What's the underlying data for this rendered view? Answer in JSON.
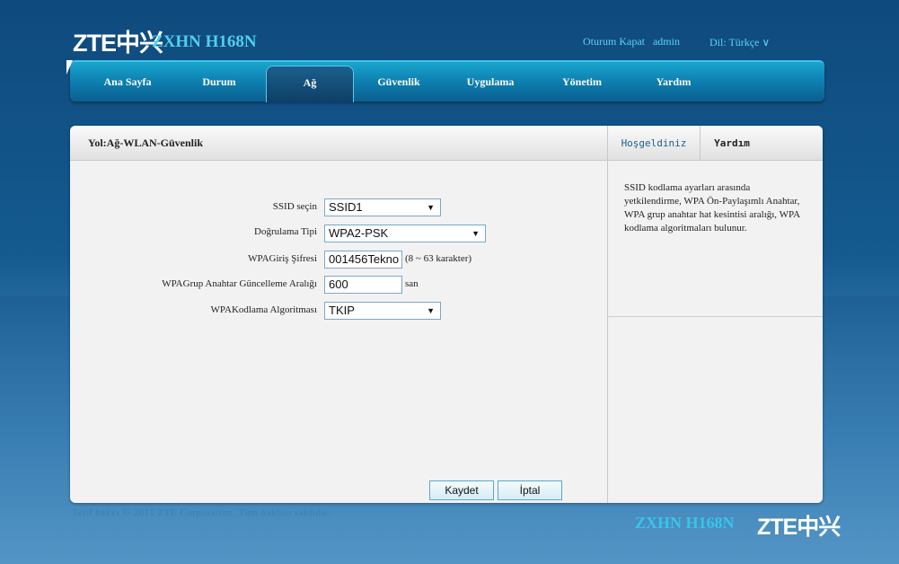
{
  "brand": {
    "logo": "ZTE中兴",
    "model": "ZXHN H168N"
  },
  "header": {
    "logout": "Oturum Kapat",
    "user": "admin",
    "language": "Dil: Türkçe ∨"
  },
  "nav": {
    "items": [
      {
        "label": "Ana Sayfa"
      },
      {
        "label": "Durum"
      },
      {
        "label": "Ağ"
      },
      {
        "label": "Güvenlik"
      },
      {
        "label": "Uygulama"
      },
      {
        "label": "Yönetim"
      },
      {
        "label": "Yardım"
      }
    ],
    "active": "Ağ"
  },
  "breadcrumb": "Yol:Ağ-WLAN-Güvenlik",
  "form": {
    "ssid": {
      "label": "SSID seçin",
      "value": "SSID1"
    },
    "auth_type": {
      "label": "Doğrulama Tipi",
      "value": "WPA2-PSK"
    },
    "password": {
      "label": "WPAGiriş Şifresi",
      "value": "001456Tekno",
      "hint": "(8 ~ 63 karakter)"
    },
    "group_key_interval": {
      "label": "WPAGrup Anahtar Güncelleme Aralığı",
      "value": "600",
      "unit": "san"
    },
    "encryption": {
      "label": "WPAKodlama Algoritması",
      "value": "TKIP"
    }
  },
  "buttons": {
    "save": "Kaydet",
    "cancel": "İptal"
  },
  "side": {
    "tab_welcome": "Hoşgeldiniz",
    "tab_help": "Yardım",
    "help_text": "SSID kodlama ayarları arasında yetkilendirme, WPA Ön-Paylaşımlı Anahtar, WPA grup anahtar hat kesintisi aralığı, WPA kodlama algoritmaları bulunur."
  },
  "footer": {
    "copyright": "Telif hakkı © 2011 ZTE Corporation. Tüm hakları saklıdır.",
    "model": "ZXHN H168N",
    "logo": "ZTE中兴"
  },
  "colors": {
    "accent": "#4fd0ec",
    "nav": "#0d7fb0",
    "background": "#145a8f"
  }
}
